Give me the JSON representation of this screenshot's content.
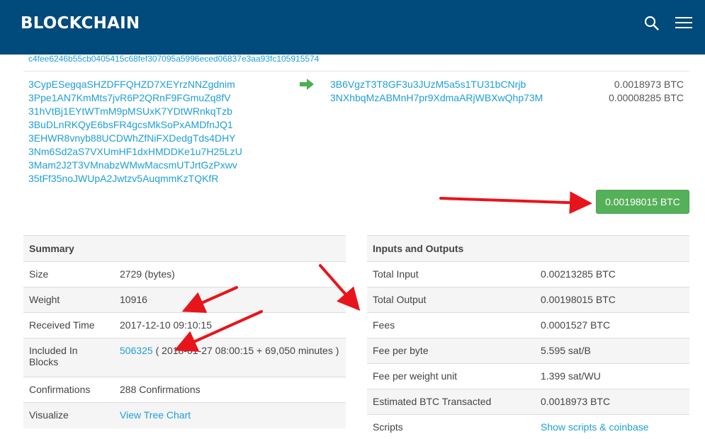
{
  "header": {
    "brand": "BLOCKCHAIN",
    "search_icon": "search-icon",
    "menu_icon": "hamburger-menu-icon",
    "background_color": "#004a7c"
  },
  "transaction": {
    "hash": "c4fee6246b55cb0405415c68fef307095a5996eced06837e3aa93fc105915574",
    "inputs": [
      "3CypESegqaSHZDFFQHZD7XEYrzNNZgdnim",
      "3Ppe1AN7KmMts7jvR6P2QRnF9FGmuZq8fV",
      "31hVtBj1EYtWTmM9pMSUxK7YDtWRnkqTzb",
      "3BuDLnRKQyE6bsFR4gcsMkSoPxAMDfnJQ1",
      "3EHWR8vnyb88UCDWhZfNiFXDedgTds4DHY",
      "3Nm6Sd2aS7VXUmHF1dxHMDDKe1u7H25LzU",
      "3Mam2J2T3VMnabzWMwMacsmUTJrtGzPxwv",
      "35tFf35noJWUpA2Jwtzv5AuqmmKzTQKfR"
    ],
    "arrow_icon": "arrow-right-icon",
    "outputs": [
      {
        "address": "3B6VgzT3T8GF3u3JUzM5a5s1TU31bCNrjb",
        "amount": "0.0018973 BTC"
      },
      {
        "address": "3NXhbqMzABMnH7pr9XdmaARjWBXwQhp73M",
        "amount": "0.00008285 BTC"
      }
    ],
    "total_button": "0.00198015 BTC",
    "total_button_color": "#55b05a"
  },
  "summary": {
    "title": "Summary",
    "size_label": "Size",
    "size_value": "2729 (bytes)",
    "weight_label": "Weight",
    "weight_value": "10916",
    "received_label": "Received Time",
    "received_value": "2017-12-10 09:10:15",
    "included_label": "Included In Blocks",
    "included_link": "506325",
    "included_rest": " ( 2018-01-27 08:00:15 + 69,050 minutes )",
    "confirmations_label": "Confirmations",
    "confirmations_value": "288 Confirmations",
    "visualize_label": "Visualize",
    "visualize_link": "View Tree Chart"
  },
  "io": {
    "title": "Inputs and Outputs",
    "total_input_label": "Total Input",
    "total_input_value": "0.00213285 BTC",
    "total_output_label": "Total Output",
    "total_output_value": "0.00198015 BTC",
    "fees_label": "Fees",
    "fees_value": "0.0001527 BTC",
    "fee_byte_label": "Fee per byte",
    "fee_byte_value": "5.595 sat/B",
    "fee_wu_label": "Fee per weight unit",
    "fee_wu_value": "1.399 sat/WU",
    "estimated_label": "Estimated BTC Transacted",
    "estimated_value": "0.0018973 BTC",
    "scripts_label": "Scripts",
    "scripts_link": "Show scripts & coinbase"
  },
  "annotations": {
    "arrow_color": "#e8141b"
  }
}
